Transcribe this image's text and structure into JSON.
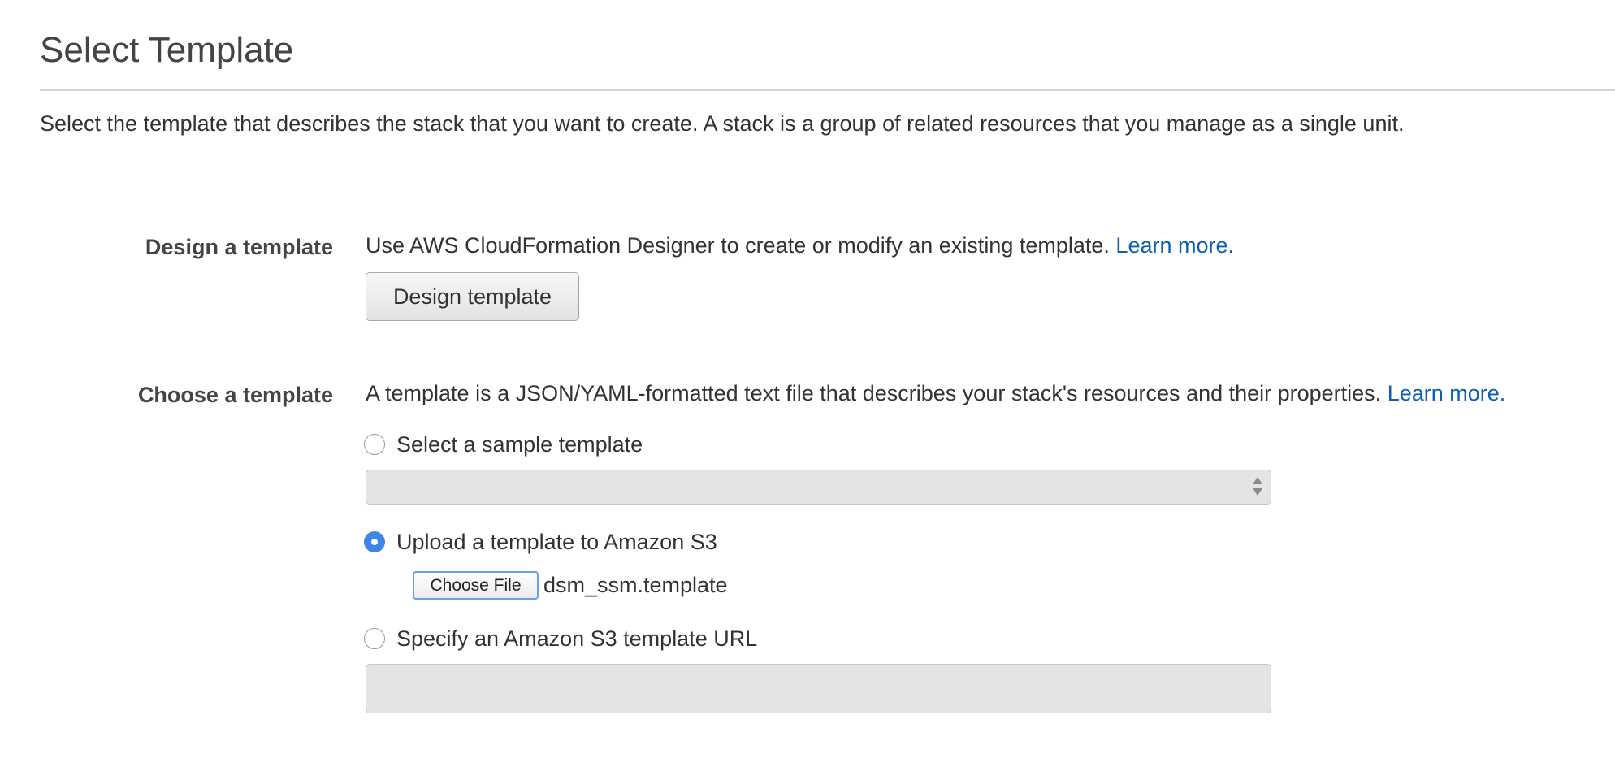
{
  "page": {
    "title": "Select Template",
    "intro": "Select the template that describes the stack that you want to create. A stack is a group of related resources that you manage as a single unit."
  },
  "design": {
    "label": "Design a template",
    "description": "Use AWS CloudFormation Designer to create or modify an existing template.",
    "learn_more": "Learn more.",
    "button_label": "Design template"
  },
  "choose": {
    "label": "Choose a template",
    "description": "A template is a JSON/YAML-formatted text file that describes your stack's resources and their properties.",
    "learn_more": "Learn more.",
    "options": [
      {
        "label": "Select a sample template",
        "checked": false
      },
      {
        "label": "Upload a template to Amazon S3",
        "checked": true
      },
      {
        "label": "Specify an Amazon S3 template URL",
        "checked": false
      }
    ],
    "sample_select_value": "",
    "file_button_label": "Choose File",
    "file_name": "dsm_ssm.template",
    "url_value": ""
  },
  "colors": {
    "link": "#0d5fb0",
    "radio_checked": "#3d85e8",
    "disabled_field": "#e4e4e4"
  },
  "icons": {
    "select_arrows": "up-down-chevron-icon"
  }
}
